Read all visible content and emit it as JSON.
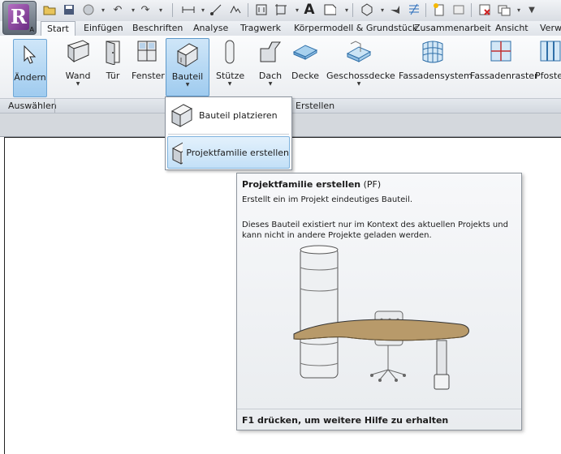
{
  "app": {
    "logo_letter": "R",
    "logo_sub": "A"
  },
  "tabs": [
    "Start",
    "Einfügen",
    "Beschriften",
    "Analyse",
    "Tragwerk",
    "Körpermodell & Grundstück",
    "Zusammenarbeit",
    "Ansicht",
    "Verwa"
  ],
  "ribbon": {
    "buttons": {
      "aendern": "Ändern",
      "wand": "Wand",
      "tuer": "Tür",
      "fenster": "Fenster",
      "bauteil": "Bauteil",
      "stuetze": "Stütze",
      "dach": "Dach",
      "decke": "Decke",
      "geschossdecke": "Geschossdecke",
      "fassadensystem": "Fassadensystem",
      "fassadenraster": "Fassadenraster",
      "pfosten": "Pfoste"
    },
    "panels": {
      "auswaehlen": "Auswählen",
      "erstellen": "Erstellen"
    }
  },
  "dropdown": {
    "item1": "Bauteil platzieren",
    "item2": "Projektfamilie erstellen"
  },
  "tooltip": {
    "title": "Projektfamilie erstellen",
    "shortcut": "(PF)",
    "description": "Erstellt ein im Projekt eindeutiges Bauteil.",
    "long_description": "Dieses Bauteil existiert nur im Kontext des aktuellen Projekts und kann nicht in andere Projekte geladen werden.",
    "help_text": "F1 drücken, um weitere Hilfe zu erhalten"
  },
  "colors": {
    "ribbon_highlight": "#9fcbef",
    "tooltip_bg": "#eef0f3",
    "logo_purple": "#6a2a82"
  }
}
